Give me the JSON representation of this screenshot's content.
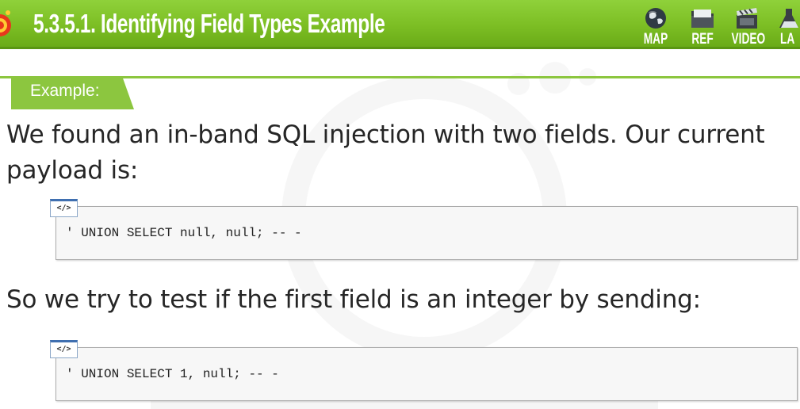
{
  "header": {
    "title": "5.3.5.1. Identifying Field Types Example",
    "background_color": "#7cbe24",
    "nav": [
      {
        "label": "MAP",
        "icon": "globe-icon"
      },
      {
        "label": "REF",
        "icon": "folder-icon"
      },
      {
        "label": "VIDEO",
        "icon": "film-clapper-icon"
      },
      {
        "label": "LA",
        "icon": "lab-flask-icon"
      }
    ]
  },
  "example": {
    "label": "Example:",
    "accent_color": "#8cc63f"
  },
  "paragraphs": {
    "intro": "We found an in-band SQL injection with two fields. Our current payload is:",
    "test": "So we try to test if the first field is an integer by sending:"
  },
  "code_blocks": [
    {
      "icon_text": "</>",
      "code": "' UNION SELECT null, null; -- -"
    },
    {
      "icon_text": "</>",
      "code": "' UNION SELECT 1, null; -- -"
    }
  ]
}
